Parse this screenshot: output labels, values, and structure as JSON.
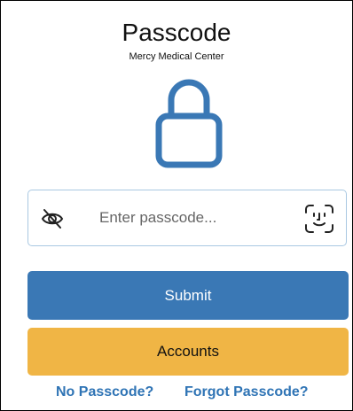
{
  "header": {
    "title": "Passcode",
    "subtitle": "Mercy Medical Center"
  },
  "passcode_field": {
    "placeholder": "Enter passcode...",
    "value": ""
  },
  "buttons": {
    "submit_label": "Submit",
    "accounts_label": "Accounts"
  },
  "links": {
    "no_passcode": "No Passcode?",
    "forgot_passcode": "Forgot Passcode?"
  },
  "icons": {
    "lock": "lock-icon",
    "visibility_toggle": "eye-slash-icon",
    "biometric": "face-id-icon"
  },
  "colors": {
    "primary": "#3a78b5",
    "accounts": "#f0b545",
    "link": "#2f74b5",
    "field_border": "#a9c8e2"
  }
}
